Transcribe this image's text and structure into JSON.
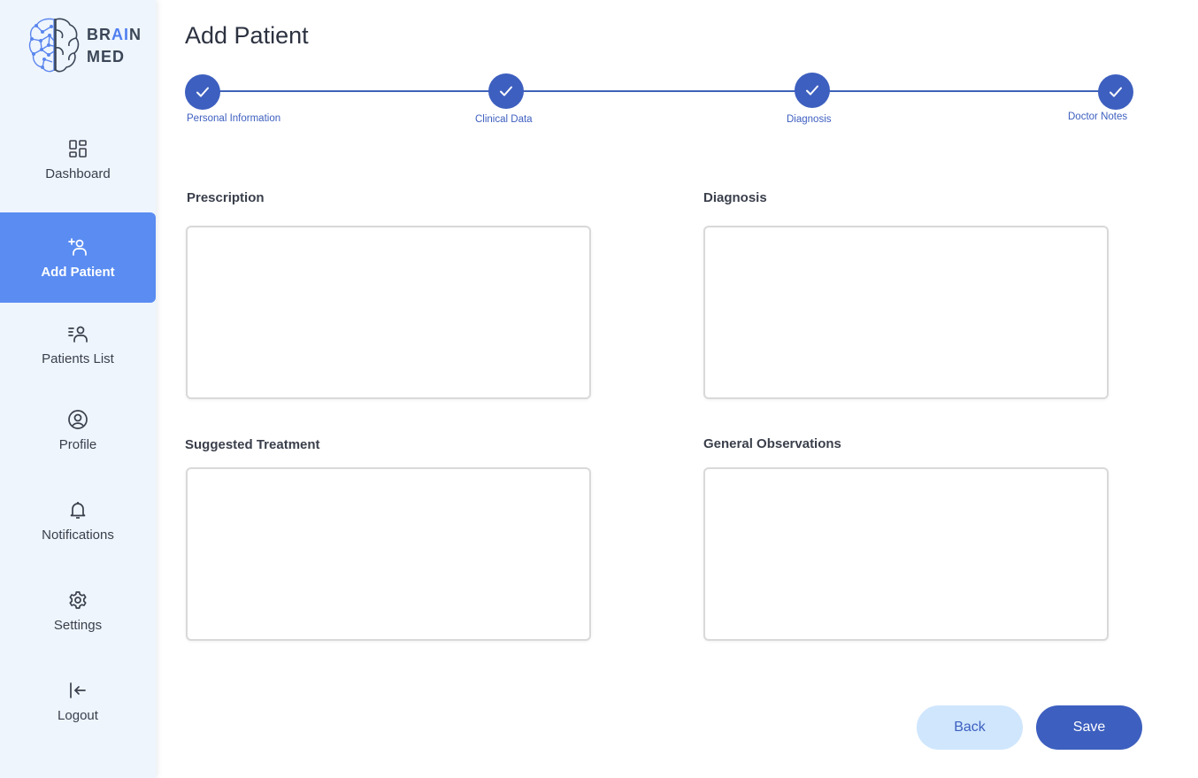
{
  "brand": {
    "line1_pre": "BR",
    "line1_accent": "AI",
    "line1_post": "N",
    "line2": "MED",
    "accent_color": "#4f7ef0"
  },
  "sidebar": {
    "items": [
      {
        "label": "Dashboard",
        "icon": "dashboard-icon"
      },
      {
        "label": "Add Patient",
        "icon": "add-user-icon",
        "active": true
      },
      {
        "label": "Patients List",
        "icon": "patients-list-icon"
      },
      {
        "label": "Profile",
        "icon": "profile-icon"
      },
      {
        "label": "Notifications",
        "icon": "bell-icon"
      },
      {
        "label": "Settings",
        "icon": "gear-icon"
      },
      {
        "label": "Logout",
        "icon": "logout-icon"
      }
    ]
  },
  "page": {
    "title": "Add Patient"
  },
  "stepper": {
    "steps": [
      {
        "label": "Personal Information",
        "completed": true
      },
      {
        "label": "Clinical Data",
        "completed": true
      },
      {
        "label": "Diagnosis",
        "completed": true
      },
      {
        "label": "Doctor Notes",
        "completed": true
      }
    ]
  },
  "form": {
    "prescription_label": "Prescription",
    "diagnosis_label": "Diagnosis",
    "treatment_label": "Suggested Treatment",
    "observations_label": "General Observations"
  },
  "actions": {
    "back_label": "Back",
    "save_label": "Save"
  },
  "colors": {
    "primary": "#3d5fbf",
    "active_nav": "#5a8cf2",
    "sidebar_bg": "#eef5fd",
    "back_button_bg": "#cfe6fd"
  }
}
